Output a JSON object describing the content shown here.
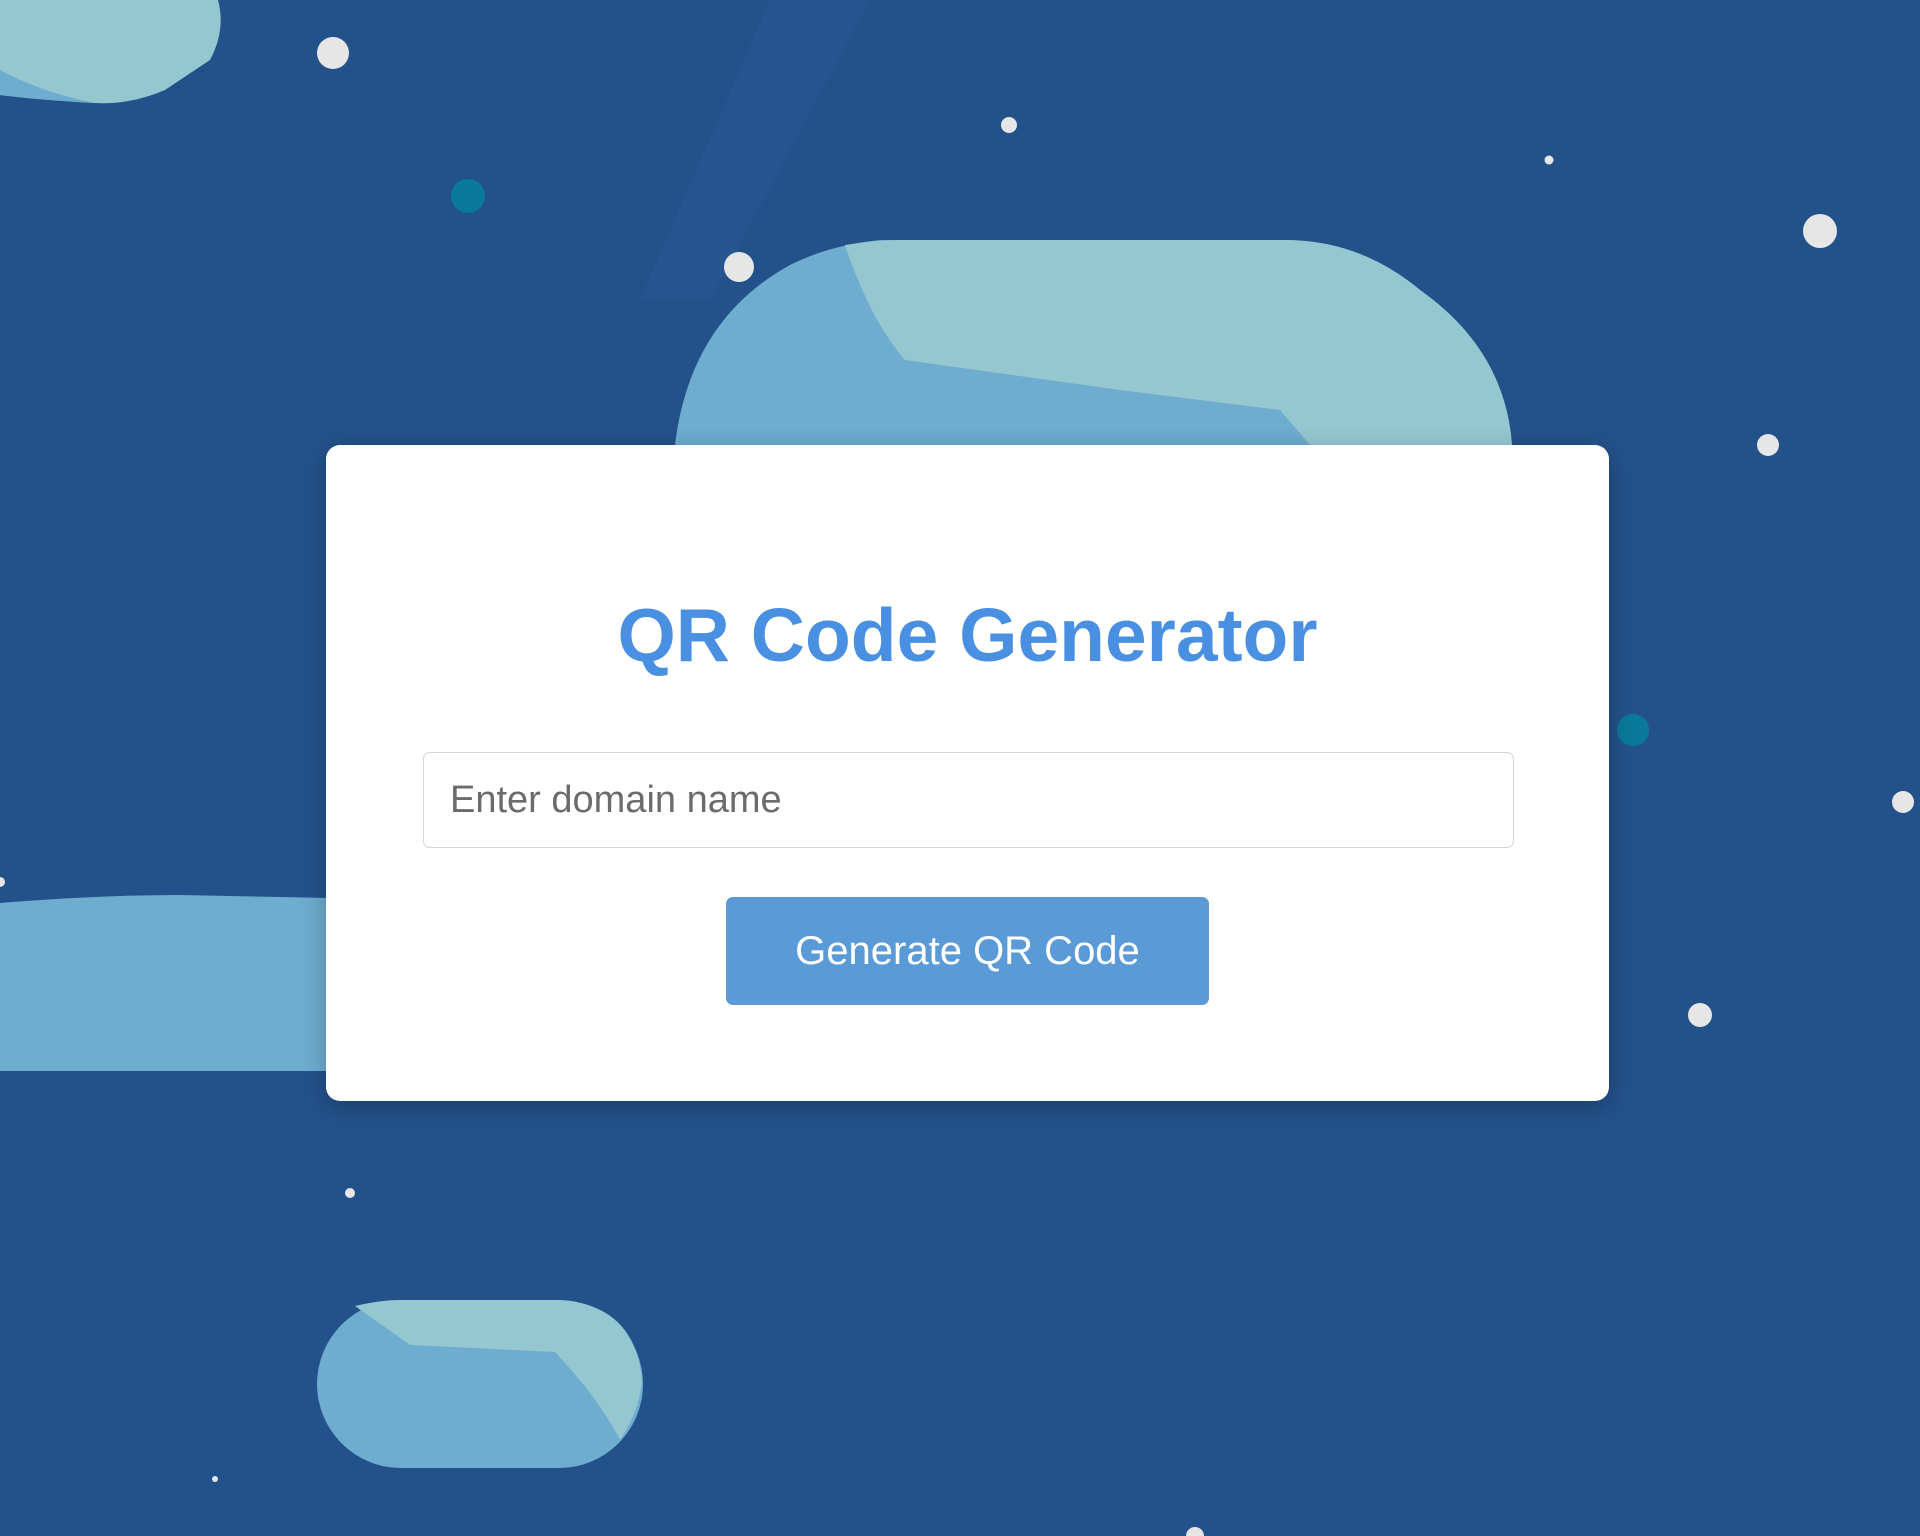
{
  "app": {
    "title": "QR Code Generator"
  },
  "form": {
    "domain_placeholder": "Enter domain name",
    "domain_value": "",
    "generate_label": "Generate QR Code"
  },
  "colors": {
    "background": "#23528a",
    "card": "#ffffff",
    "title": "#4a90e2",
    "button": "#5a9ad6",
    "blob_light": "#94c7d0",
    "blob_mid": "#6eacd0",
    "dot_white": "#e6e6e6",
    "dot_teal": "#0a7a9a"
  }
}
